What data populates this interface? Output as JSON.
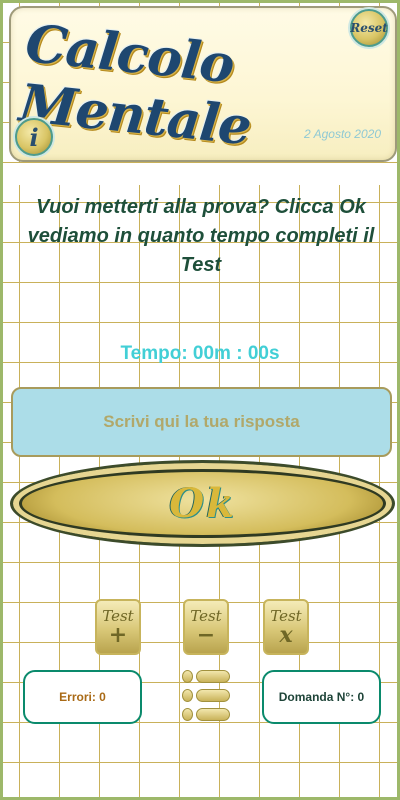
{
  "header": {
    "title": "Calcolo Mentale",
    "date": "2 Agosto 2020",
    "reset_label": "Reset",
    "info_label": "i"
  },
  "main": {
    "question": "Vuoi metterti alla prova? Clicca Ok vediamo in quanto tempo completi il Test",
    "timer": "Tempo: 00m : 00s",
    "answer_placeholder": "Scrivi qui la tua risposta",
    "ok_label": "Ok"
  },
  "tests": [
    {
      "label": "Test",
      "op": "+",
      "icon": "test-add-icon"
    },
    {
      "label": "Test",
      "op": "−",
      "icon": "test-subtract-icon"
    },
    {
      "label": "Test",
      "op": "x",
      "icon": "test-multiply-icon"
    }
  ],
  "stats": {
    "errors": "Errori: 0",
    "question_number": "Domanda N°: 0"
  },
  "icons": {
    "list": "list-icon"
  },
  "colors": {
    "title": "#1e4770",
    "question": "#1e4f3a",
    "timer": "#42cfd6",
    "answer_bg": "#acdde8",
    "grid": "#c9b15a"
  }
}
